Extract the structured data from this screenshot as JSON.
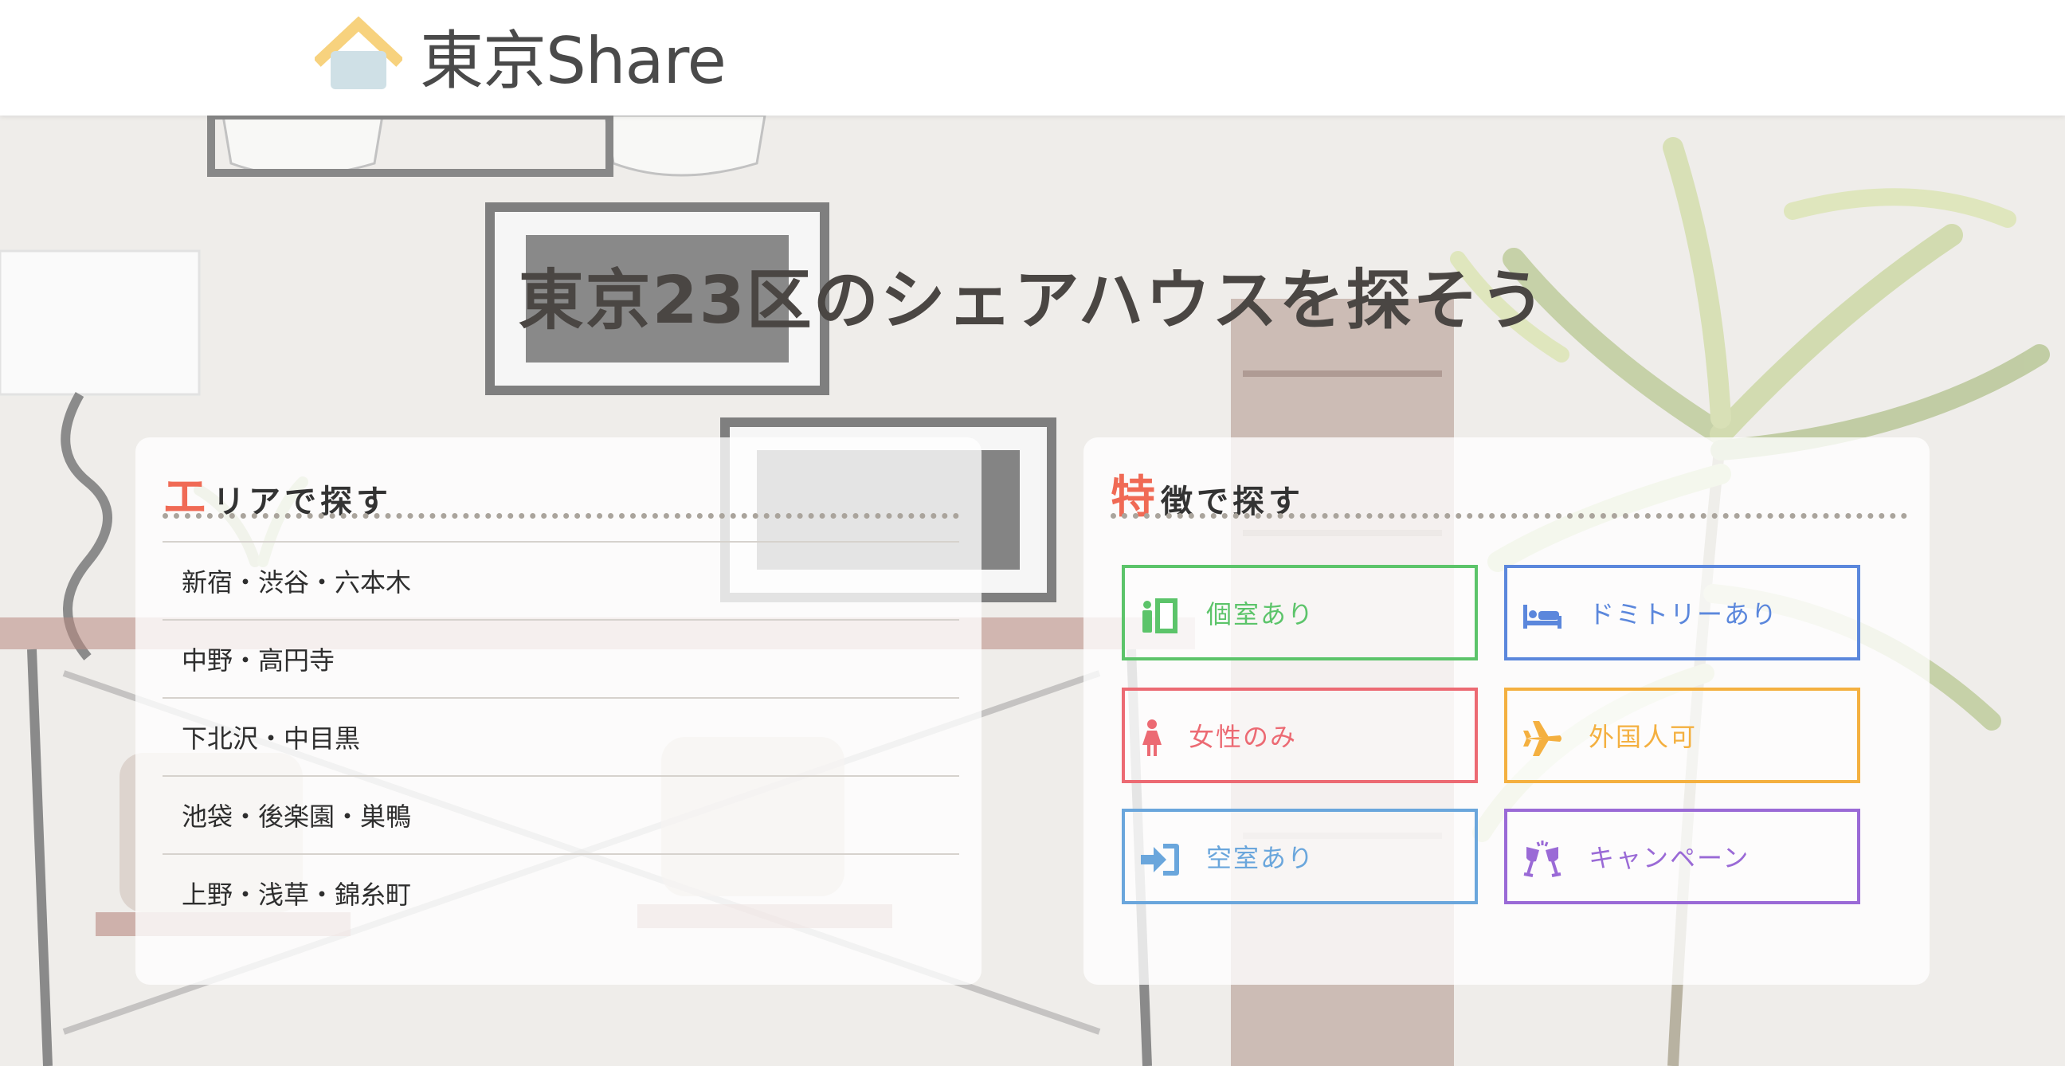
{
  "header": {
    "logo_text": "東京Share",
    "logo_colors": {
      "roof": "#f7d27e",
      "body": "#cfe0e6"
    }
  },
  "hero": {
    "title": "東京23区のシェアハウスを探そう"
  },
  "area_panel": {
    "title_accent": "エ",
    "title_rest": "リアで探す",
    "items": [
      {
        "label": "新宿・渋谷・六本木"
      },
      {
        "label": "中野・高円寺"
      },
      {
        "label": "下北沢・中目黒"
      },
      {
        "label": "池袋・後楽園・巣鴨"
      },
      {
        "label": "上野・浅草・錦糸町"
      }
    ]
  },
  "feature_panel": {
    "title_accent": "特",
    "title_rest": "徴で探す",
    "buttons": [
      {
        "label": "個室あり",
        "icon": "private-room-icon",
        "color": "#5cc46a"
      },
      {
        "label": "ドミトリーあり",
        "icon": "bed-icon",
        "color": "#5b87dc"
      },
      {
        "label": "女性のみ",
        "icon": "female-icon",
        "color": "#ec6a73"
      },
      {
        "label": "外国人可",
        "icon": "airplane-icon",
        "color": "#f4b040"
      },
      {
        "label": "空室あり",
        "icon": "sign-in-icon",
        "color": "#6aa6dc"
      },
      {
        "label": "キャンペーン",
        "icon": "cheers-icon",
        "color": "#9a6ad6"
      }
    ]
  }
}
